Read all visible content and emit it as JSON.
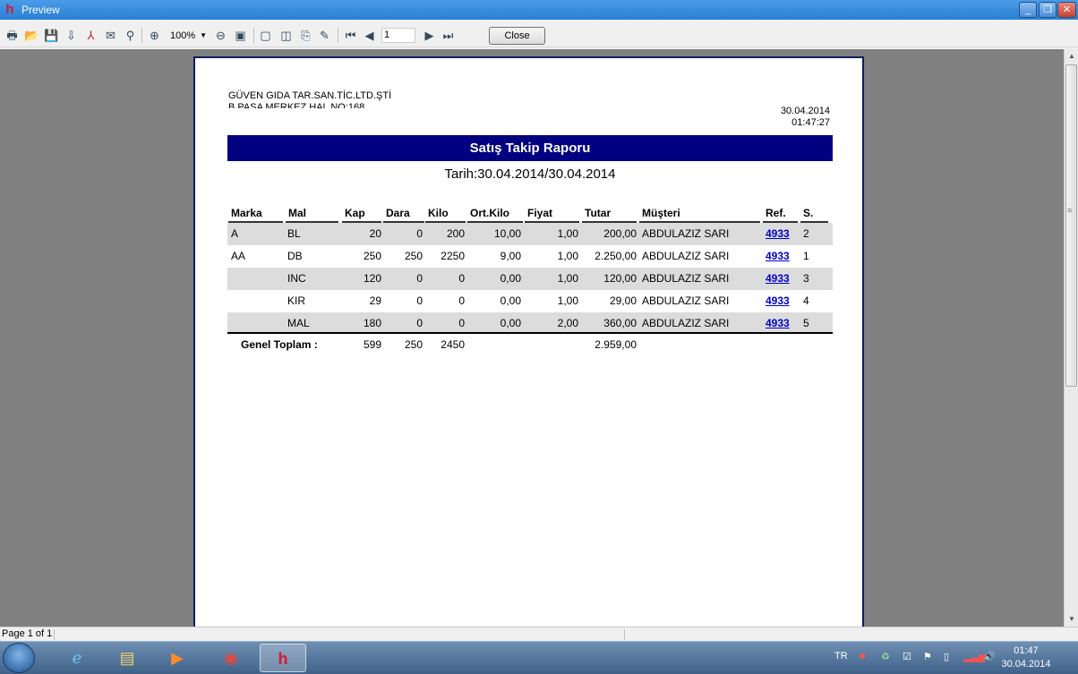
{
  "window": {
    "title": "Preview",
    "min_label": "_",
    "max_label": "❐",
    "close_label": "✕"
  },
  "toolbar": {
    "zoom_value": "100%",
    "page_number": "1",
    "close_label": "Close"
  },
  "report": {
    "company_name": "GÜVEN GIDA TAR.SAN.TİC.LTD.ŞTİ",
    "company_address": "B.PAŞA MERKEZ HAL NO:168",
    "print_date": "30.04.2014",
    "print_time": "01:47:27",
    "title": "Satış Takip Raporu",
    "date_range": "Tarih:30.04.2014/30.04.2014",
    "columns": [
      "Marka",
      "Mal",
      "Kap",
      "Dara",
      "Kilo",
      "Ort.Kilo",
      "Fiyat",
      "Tutar",
      "Müşteri",
      "Ref.",
      "S."
    ],
    "rows": [
      {
        "marka": "A",
        "mal": "BL",
        "kap": "20",
        "dara": "0",
        "kilo": "200",
        "ort": "10,00",
        "fiyat": "1,00",
        "tutar": "200,00",
        "musteri": "ABDULAZIZ SARI",
        "ref": "4933",
        "s": "2"
      },
      {
        "marka": "AA",
        "mal": "DB",
        "kap": "250",
        "dara": "250",
        "kilo": "2250",
        "ort": "9,00",
        "fiyat": "1,00",
        "tutar": "2.250,00",
        "musteri": "ABDULAZIZ SARI",
        "ref": "4933",
        "s": "1"
      },
      {
        "marka": "",
        "mal": "INC",
        "kap": "120",
        "dara": "0",
        "kilo": "0",
        "ort": "0,00",
        "fiyat": "1,00",
        "tutar": "120,00",
        "musteri": "ABDULAZIZ SARI",
        "ref": "4933",
        "s": "3"
      },
      {
        "marka": "",
        "mal": "KIR",
        "kap": "29",
        "dara": "0",
        "kilo": "0",
        "ort": "0,00",
        "fiyat": "1,00",
        "tutar": "29,00",
        "musteri": "ABDULAZIZ SARI",
        "ref": "4933",
        "s": "4"
      },
      {
        "marka": "",
        "mal": "MAL",
        "kap": "180",
        "dara": "0",
        "kilo": "0",
        "ort": "0,00",
        "fiyat": "2,00",
        "tutar": "360,00",
        "musteri": "ABDULAZIZ SARI",
        "ref": "4933",
        "s": "5"
      }
    ],
    "totals": {
      "label": "Genel Toplam :",
      "kap": "599",
      "dara": "250",
      "kilo": "2450",
      "tutar": "2.959,00"
    }
  },
  "status": {
    "page_info": "Page 1 of 1"
  },
  "taskbar": {
    "language": "TR",
    "time": "01:47",
    "date": "30.04.2014"
  }
}
